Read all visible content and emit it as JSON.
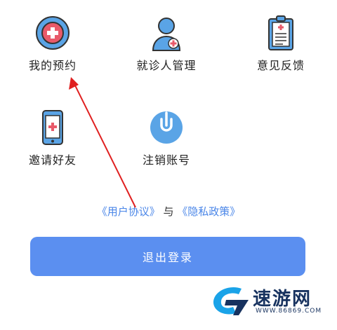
{
  "menu": [
    {
      "label": "我的预约",
      "icon": "appointment-icon"
    },
    {
      "label": "就诊人管理",
      "icon": "patient-manage-icon"
    },
    {
      "label": "意见反馈",
      "icon": "feedback-clipboard-icon"
    },
    {
      "label": "邀请好友",
      "icon": "phone-invite-icon"
    },
    {
      "label": "注销账号",
      "icon": "power-icon"
    }
  ],
  "policy": {
    "user_agreement": "《用户协议》",
    "and": "与",
    "privacy_policy": "《隐私政策》"
  },
  "logout": {
    "label": "退出登录"
  },
  "watermark": {
    "name": "速游网",
    "url": "WWW.86869.COM"
  },
  "colors": {
    "accent": "#5b8ff0",
    "icon_blue": "#5aa4e6",
    "icon_red": "#e85a6a",
    "arrow": "#e02020",
    "link": "#4a86e8"
  }
}
